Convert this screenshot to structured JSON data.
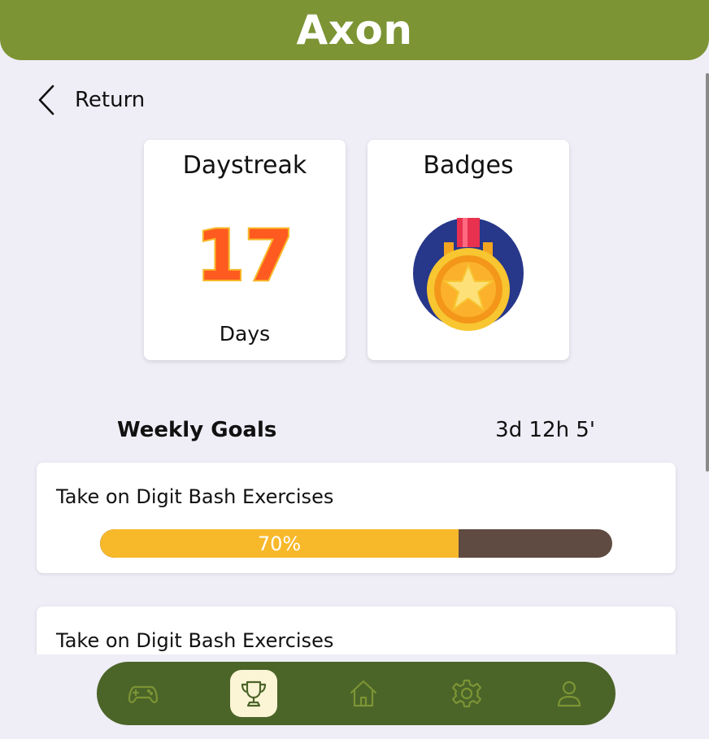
{
  "app": {
    "title": "Axon"
  },
  "nav_back": {
    "label": "Return",
    "icon": "chevron-left-icon"
  },
  "streak_card": {
    "title": "Daystreak",
    "count": "17",
    "unit": "Days"
  },
  "badges_card": {
    "title": "Badges",
    "icon": "medal-icon"
  },
  "weekly_goals": {
    "title": "Weekly Goals",
    "time_remaining": "3d 12h 5'",
    "goals": [
      {
        "title": "Take on Digit Bash Exercises",
        "progress": 0.7,
        "progress_label": "70%"
      },
      {
        "title": "Take on Digit Bash Exercises"
      }
    ]
  },
  "bottom_nav": {
    "items": [
      {
        "name": "games",
        "icon": "gamepad-icon",
        "active": false
      },
      {
        "name": "achievements",
        "icon": "trophy-icon",
        "active": true
      },
      {
        "name": "home",
        "icon": "home-icon",
        "active": false
      },
      {
        "name": "settings",
        "icon": "gear-icon",
        "active": false
      },
      {
        "name": "profile",
        "icon": "user-icon",
        "active": false
      }
    ]
  },
  "colors": {
    "header": "#7c9434",
    "background": "#efeef7",
    "nav_bar": "#4b6428",
    "nav_icon": "#7c9434",
    "nav_active_bg": "#fbf5d6",
    "progress_fill": "#f7b82a",
    "progress_track": "#5f4b42",
    "streak_number": "#ff5a1f"
  }
}
